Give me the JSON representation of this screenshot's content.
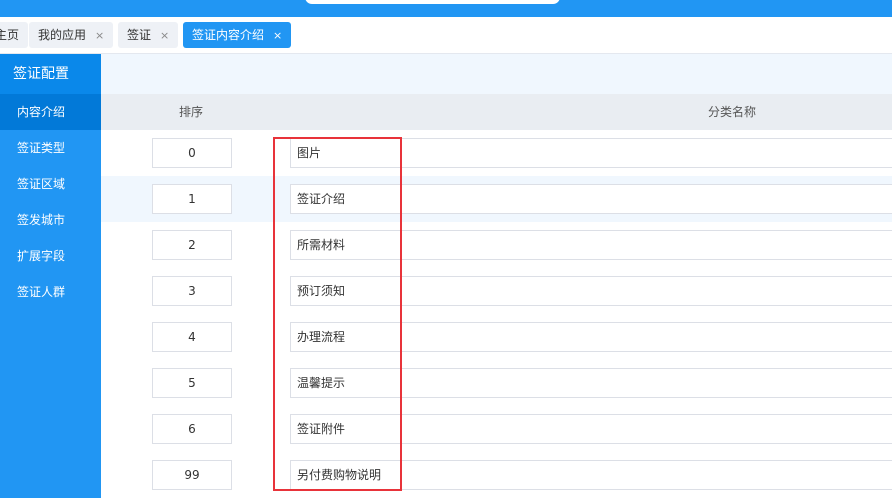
{
  "tabs": [
    {
      "label": "主页",
      "closable": false
    },
    {
      "label": "我的应用",
      "closable": true
    },
    {
      "label": "签证",
      "closable": true
    },
    {
      "label": "签证内容介绍",
      "closable": true,
      "active": true
    }
  ],
  "close_glyph": "×",
  "sidebar": {
    "title": "签证配置",
    "items": [
      {
        "label": "内容介绍",
        "active": true
      },
      {
        "label": "签证类型"
      },
      {
        "label": "签证区域"
      },
      {
        "label": "签发城市"
      },
      {
        "label": "扩展字段"
      },
      {
        "label": "签证人群"
      }
    ]
  },
  "table": {
    "headers": {
      "order": "排序",
      "name": "分类名称"
    },
    "rows": [
      {
        "order": "0",
        "name": "图片"
      },
      {
        "order": "1",
        "name": "签证介绍"
      },
      {
        "order": "2",
        "name": "所需材料"
      },
      {
        "order": "3",
        "name": "预订须知"
      },
      {
        "order": "4",
        "name": "办理流程"
      },
      {
        "order": "5",
        "name": "温馨提示"
      },
      {
        "order": "6",
        "name": "签证附件"
      },
      {
        "order": "99",
        "name": "另付费购物说明"
      }
    ]
  },
  "colors": {
    "primary": "#2196f3",
    "highlight_box": "#e8333a"
  }
}
